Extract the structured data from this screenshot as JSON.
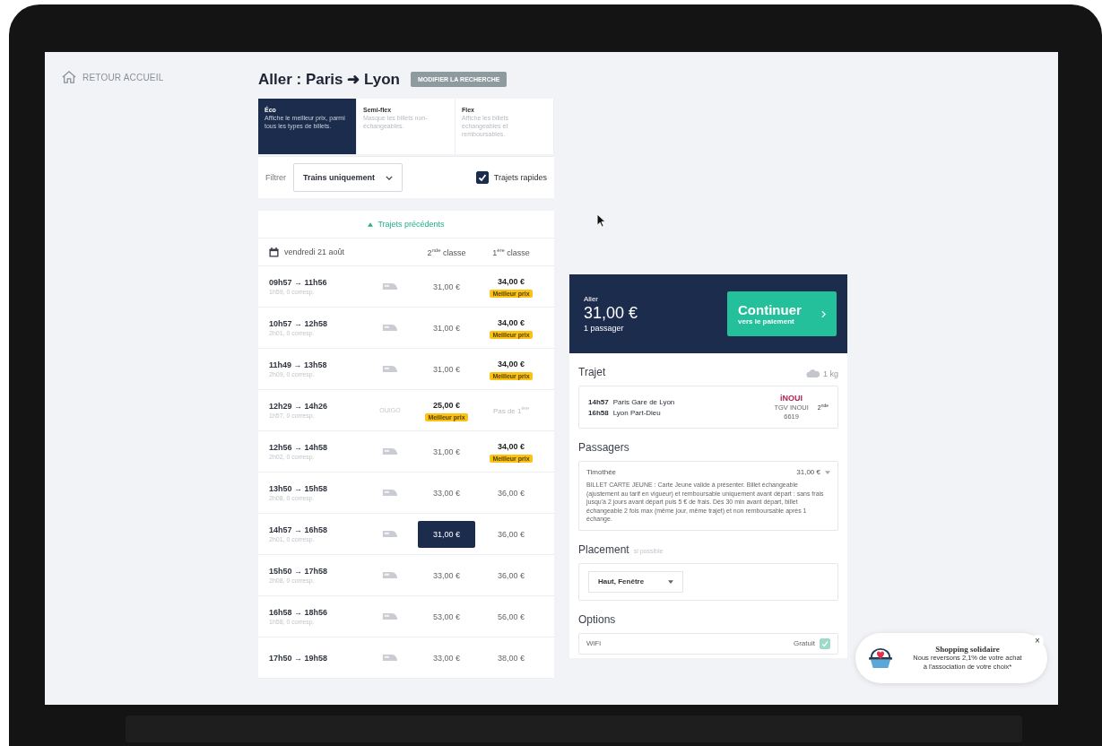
{
  "nav": {
    "back_label": "RETOUR ACCUEIL"
  },
  "header": {
    "title": "Aller : Paris ➜ Lyon",
    "modify_button": "MODIFIER LA RECHERCHE"
  },
  "fare_tabs": [
    {
      "label": "Éco",
      "description": "Affiche le meilleur prix, parmi tous les types de billets.",
      "selected": true
    },
    {
      "label": "Semi-flex",
      "description": "Masque les billets non-échangeables.",
      "selected": false
    },
    {
      "label": "Flex",
      "description": "Affiche les billets échangeables et remboursables.",
      "selected": false
    }
  ],
  "filter": {
    "label": "Filtrer",
    "select_value": "Trains uniquement",
    "checkbox_label": "Trajets rapides",
    "checked": true
  },
  "previous_link": "Trajets précédents",
  "table": {
    "date": "vendredi 21 août",
    "columns": [
      "2$^{nde}$ classe",
      "1$^{ère}$ classe"
    ],
    "rows": [
      {
        "times": "09h57 → 11h56",
        "duration": "1h59, 0 corresp.",
        "carrier": {
          "kind": "icon"
        },
        "prices": [
          {
            "text": "31,00 €",
            "best": false,
            "selected": false,
            "available": true
          },
          {
            "text": "34,00 €",
            "best": true,
            "badge": "Meilleur prix",
            "selected": false,
            "available": true
          }
        ]
      },
      {
        "times": "10h57 → 12h58",
        "duration": "2h01, 0 corresp.",
        "carrier": {
          "kind": "icon"
        },
        "prices": [
          {
            "text": "31,00 €",
            "best": false,
            "selected": false,
            "available": true
          },
          {
            "text": "34,00 €",
            "best": true,
            "badge": "Meilleur prix",
            "selected": false,
            "available": true
          }
        ]
      },
      {
        "times": "11h49 → 13h58",
        "duration": "2h09, 0 corresp.",
        "carrier": {
          "kind": "icon"
        },
        "prices": [
          {
            "text": "31,00 €",
            "best": false,
            "selected": false,
            "available": true
          },
          {
            "text": "34,00 €",
            "best": true,
            "badge": "Meilleur prix",
            "selected": false,
            "available": true
          }
        ]
      },
      {
        "times": "12h29 → 14h26",
        "duration": "1h57, 0 corresp.",
        "carrier": {
          "kind": "text",
          "label": "OUIGO"
        },
        "prices": [
          {
            "text": "25,00 €",
            "best": true,
            "badge": "Meilleur prix",
            "selected": false,
            "available": true
          },
          {
            "text": "Pas de 1$^{ère}$",
            "best": false,
            "selected": false,
            "available": false
          }
        ]
      },
      {
        "times": "12h56 → 14h58",
        "duration": "2h02, 0 corresp.",
        "carrier": {
          "kind": "icon"
        },
        "prices": [
          {
            "text": "31,00 €",
            "best": false,
            "selected": false,
            "available": true
          },
          {
            "text": "34,00 €",
            "best": true,
            "badge": "Meilleur prix",
            "selected": false,
            "available": true
          }
        ]
      },
      {
        "times": "13h50 → 15h58",
        "duration": "2h08, 0 corresp.",
        "carrier": {
          "kind": "icon"
        },
        "prices": [
          {
            "text": "33,00 €",
            "best": false,
            "selected": false,
            "available": true
          },
          {
            "text": "36,00 €",
            "best": false,
            "selected": false,
            "available": true
          }
        ]
      },
      {
        "times": "14h57 → 16h58",
        "duration": "2h01, 0 corresp.",
        "carrier": {
          "kind": "icon"
        },
        "prices": [
          {
            "text": "31,00 €",
            "best": false,
            "selected": true,
            "available": true
          },
          {
            "text": "36,00 €",
            "best": false,
            "selected": false,
            "available": true
          }
        ]
      },
      {
        "times": "15h50 → 17h58",
        "duration": "2h08, 0 corresp.",
        "carrier": {
          "kind": "icon"
        },
        "prices": [
          {
            "text": "33,00 €",
            "best": false,
            "selected": false,
            "available": true
          },
          {
            "text": "36,00 €",
            "best": false,
            "selected": false,
            "available": true
          }
        ]
      },
      {
        "times": "16h58 → 18h56",
        "duration": "1h58, 0 corresp.",
        "carrier": {
          "kind": "icon"
        },
        "prices": [
          {
            "text": "53,00 €",
            "best": false,
            "selected": false,
            "available": true
          },
          {
            "text": "56,00 €",
            "best": false,
            "selected": false,
            "available": true
          }
        ]
      },
      {
        "times": "17h50 → 19h58",
        "carrier": {
          "kind": "icon"
        },
        "prices": [
          {
            "text": "33,00 €",
            "best": false,
            "selected": false,
            "available": true
          },
          {
            "text": "38,00 €",
            "best": false,
            "selected": false,
            "available": true
          }
        ]
      }
    ]
  },
  "summary": {
    "label": "Aller",
    "price": "31,00 €",
    "passengers": "1 passager",
    "continue_title": "Continuer",
    "continue_subtitle": "vers le paiement"
  },
  "trip": {
    "heading": "Trajet",
    "co2": "1 kg",
    "stops": [
      {
        "time": "14h57",
        "station": "Paris Gare de Lyon"
      },
      {
        "time": "16h58",
        "station": "Lyon Part-Dieu"
      }
    ],
    "brand_logo": "iNOUI",
    "train_type": "TGV INOUI",
    "train_number": "6619",
    "class": "2$^{nde}$"
  },
  "passengers": {
    "heading": "Passagers",
    "items": [
      {
        "name": "Timothée",
        "price": "31,00 €",
        "conditions": "BILLET CARTE JEUNE : Carte Jeune valide à présenter. Billet échangeable (ajustement au tarif en vigueur) et remboursable uniquement avant départ : sans frais jusqu'à 2 jours avant départ puis 5 € de frais. Dès 30 min avant départ, billet échangeable 2 fois max (même jour, même trajet) et non remboursable après 1 échange."
      }
    ]
  },
  "placement": {
    "heading": "Placement",
    "hint": "si possible",
    "value": "Haut, Fenêtre"
  },
  "options": {
    "heading": "Options",
    "items": [
      {
        "name": "WiFi",
        "price": "Gratuit",
        "checked": true
      }
    ]
  },
  "toast": {
    "title": "Shopping solidaire",
    "lines": [
      "Nous reversons 2,1% de votre achat",
      "à l'association de votre choix*"
    ],
    "close": "×"
  }
}
